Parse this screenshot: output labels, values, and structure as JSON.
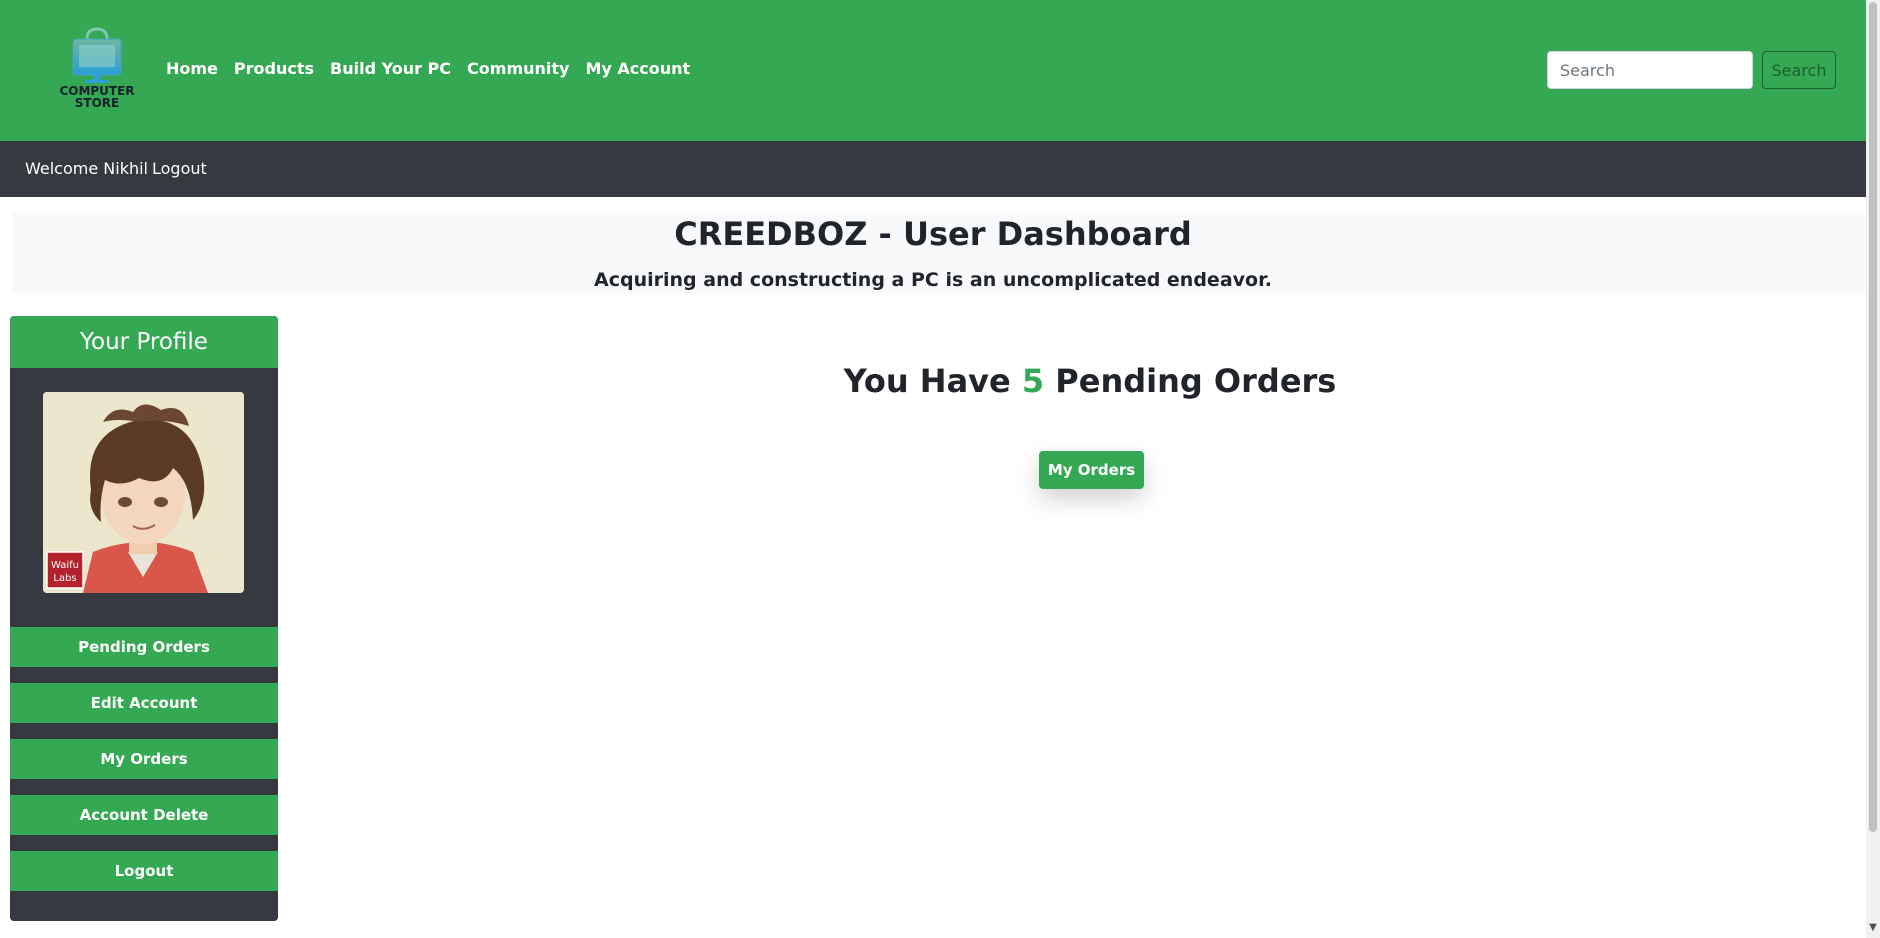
{
  "brand": {
    "logo_text": "COMPUTER STORE"
  },
  "nav": {
    "links": [
      "Home",
      "Products",
      "Build Your PC",
      "Community",
      "My Account"
    ]
  },
  "search": {
    "placeholder": "Search",
    "button": "Search"
  },
  "userbar": {
    "welcome": "Welcome Nikhil",
    "logout": "Logout"
  },
  "hero": {
    "title": "CREEDBOZ - User Dashboard",
    "subtitle": "Acquiring and constructing a PC is an uncomplicated endeavor."
  },
  "sidebar": {
    "title": "Your Profile",
    "avatar_badge": "Waifu Labs",
    "buttons": [
      "Pending Orders",
      "Edit Account",
      "My Orders",
      "Account Delete",
      "Logout"
    ]
  },
  "main": {
    "pending_prefix": "You Have",
    "pending_count": "5",
    "pending_suffix": "Pending Orders",
    "orders_button": "My Orders"
  },
  "colors": {
    "accent": "#34a853",
    "dark": "#343a40",
    "hero_bg": "#f8f9fa"
  },
  "icons": {
    "logo": "shopping-bag-monitor-icon",
    "scroll_down": "chevron-down-icon"
  }
}
